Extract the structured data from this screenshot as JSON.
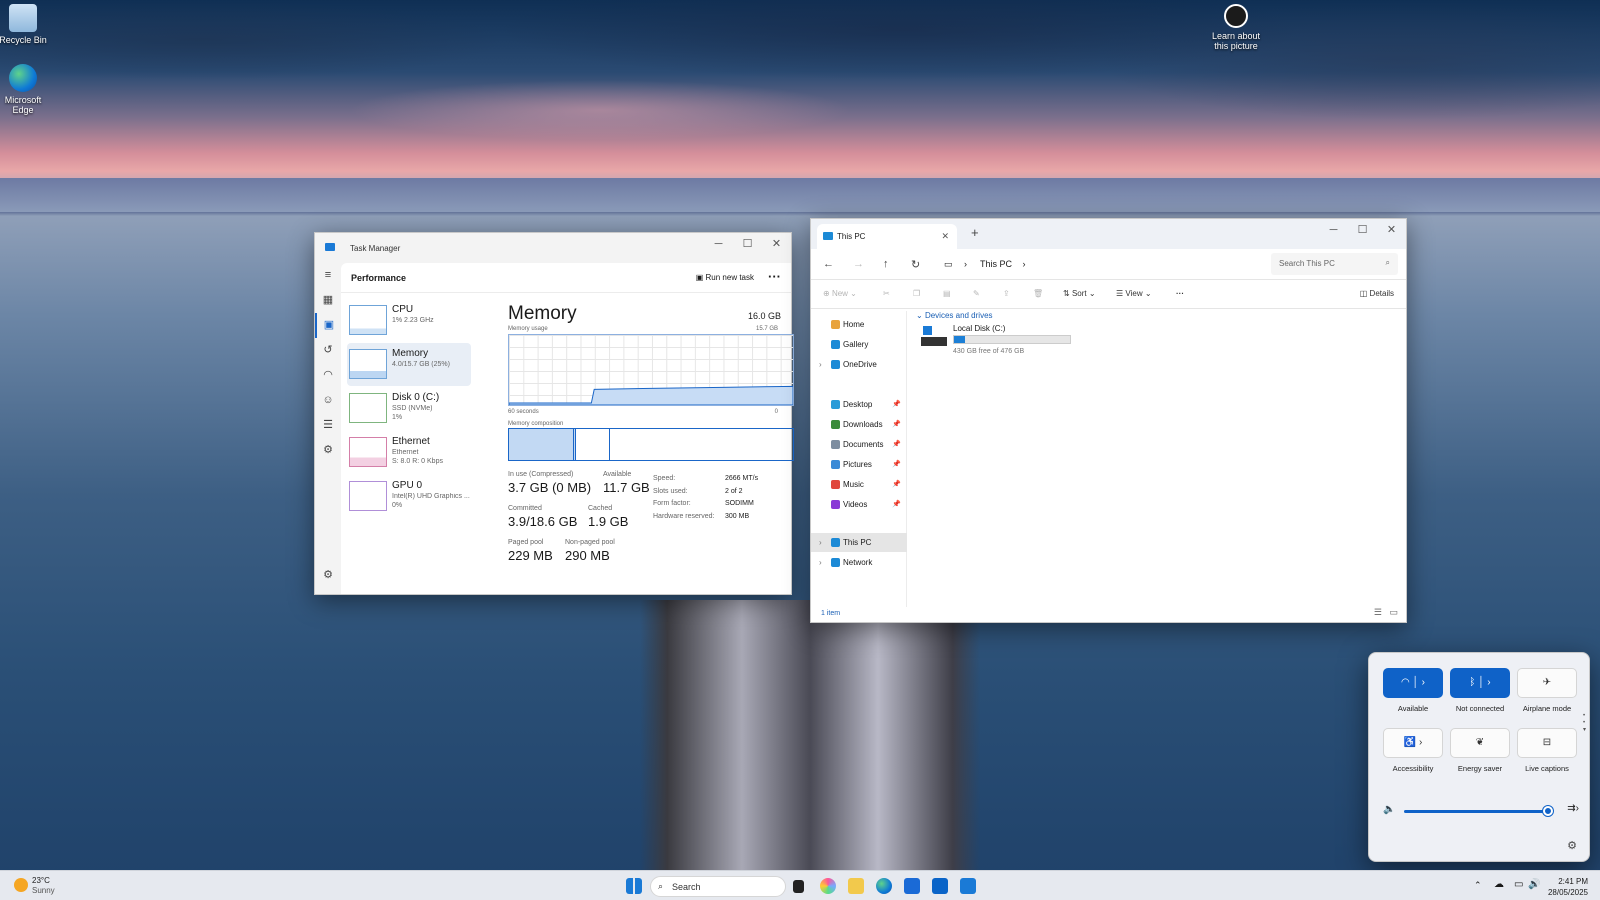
{
  "desktop": {
    "icons": [
      {
        "label": "Recycle Bin"
      },
      {
        "label": "Microsoft Edge"
      },
      {
        "label": "Learn about this picture"
      }
    ]
  },
  "taskmanager": {
    "title": "Task Manager",
    "section": "Performance",
    "run_task": "Run new task",
    "perf_items": [
      {
        "name": "CPU",
        "sub": "1% 2.23 GHz",
        "sub2": ""
      },
      {
        "name": "Memory",
        "sub": "4.0/15.7 GB (25%)",
        "sub2": ""
      },
      {
        "name": "Disk 0 (C:)",
        "sub": "SSD (NVMe)",
        "sub2": "1%"
      },
      {
        "name": "Ethernet",
        "sub": "Ethernet",
        "sub2": "S: 8.0 R: 0 Kbps"
      },
      {
        "name": "GPU 0",
        "sub": "Intel(R) UHD Graphics ...",
        "sub2": "0%"
      }
    ],
    "memory": {
      "heading": "Memory",
      "total": "16.0 GB",
      "usage_label": "Memory usage",
      "usage_max": "15.7 GB",
      "time_label": "60 seconds",
      "zero": "0",
      "composition_label": "Memory composition",
      "usage_fraction": 0.25,
      "stats": {
        "in_use_label": "In use (Compressed)",
        "in_use": "3.7 GB (0 MB)",
        "available_label": "Available",
        "available": "11.7 GB",
        "committed_label": "Committed",
        "committed": "3.9/18.6 GB",
        "cached_label": "Cached",
        "cached": "1.9 GB",
        "paged_label": "Paged pool",
        "paged": "229 MB",
        "nonpaged_label": "Non-paged pool",
        "nonpaged": "290 MB"
      },
      "details": [
        {
          "k": "Speed:",
          "v": "2666 MT/s"
        },
        {
          "k": "Slots used:",
          "v": "2 of 2"
        },
        {
          "k": "Form factor:",
          "v": "SODIMM"
        },
        {
          "k": "Hardware reserved:",
          "v": "300 MB"
        }
      ]
    }
  },
  "explorer": {
    "tab": "This PC",
    "address": "This PC",
    "search_placeholder": "Search This PC",
    "toolbar": {
      "new": "New",
      "sort": "Sort",
      "view": "View",
      "details": "Details"
    },
    "nav": [
      {
        "label": "Home",
        "color": "#e8a33d",
        "pin": false
      },
      {
        "label": "Gallery",
        "color": "#1c8ad6",
        "pin": false
      },
      {
        "label": "OneDrive",
        "color": "#1c8ad6",
        "pin": false
      },
      {
        "label": "Desktop",
        "color": "#2a9bd8",
        "pin": true
      },
      {
        "label": "Downloads",
        "color": "#3a8a3a",
        "pin": true
      },
      {
        "label": "Documents",
        "color": "#7d8da0",
        "pin": true
      },
      {
        "label": "Pictures",
        "color": "#3a8ad6",
        "pin": true
      },
      {
        "label": "Music",
        "color": "#e0483d",
        "pin": true
      },
      {
        "label": "Videos",
        "color": "#8a3ad6",
        "pin": true
      },
      {
        "label": "This PC",
        "color": "#1c8ad6",
        "pin": false
      },
      {
        "label": "Network",
        "color": "#1c8ad6",
        "pin": false
      }
    ],
    "group": "Devices and drives",
    "drive": {
      "name": "Local Disk (C:)",
      "free": "430 GB free of 476 GB",
      "used_fraction": 0.097
    },
    "status": "1 item"
  },
  "quick": {
    "tiles": [
      {
        "label": "Available"
      },
      {
        "label": "Not connected"
      },
      {
        "label": "Airplane mode"
      },
      {
        "label": "Accessibility"
      },
      {
        "label": "Energy saver"
      },
      {
        "label": "Live captions"
      }
    ],
    "volume": 0.97
  },
  "taskbar": {
    "temp": "23°C",
    "weather": "Sunny",
    "search": "Search",
    "time": "2:41 PM",
    "date": "28/05/2025"
  }
}
